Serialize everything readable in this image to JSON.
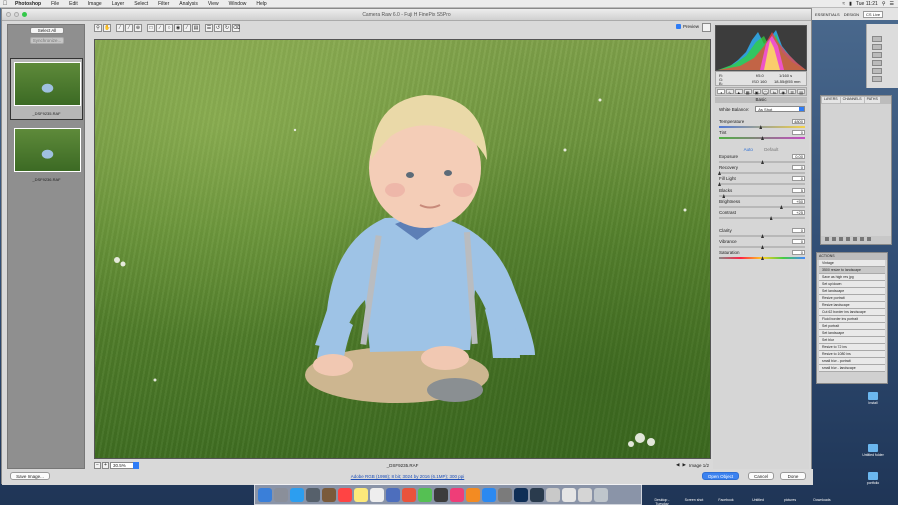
{
  "menubar": {
    "apple": "",
    "items": [
      "Photoshop",
      "File",
      "Edit",
      "Image",
      "Layer",
      "Select",
      "Filter",
      "Analysis",
      "View",
      "Window",
      "Help"
    ],
    "clock": "Tue 11:21"
  },
  "dialog": {
    "title": "Camera Raw 6.0 - Fuji H FinePix S5Pro",
    "select_all": "Select All",
    "synchronize": "Synchronize...",
    "thumbnails": [
      {
        "name": "_DSF9235.RAF",
        "selected": true
      },
      {
        "name": "_DSF9236.RAF",
        "selected": false
      }
    ],
    "preview_label": "Preview",
    "zoom": "30.5%",
    "filename": "_DSF9235.RAF",
    "image_count": "Image 1/2",
    "info_link": "Adobe RGB (1998); 8 bit; 3024 by 2016 (6.1MP); 300 ppi",
    "save_button": "Save Image...",
    "open_button": "Open Object",
    "cancel_button": "Cancel",
    "done_button": "Done"
  },
  "rawpanel": {
    "readout": {
      "r_label": "R:",
      "g_label": "G:",
      "b_label": "B:",
      "aperture": "f/5.0",
      "shutter": "1/160 s",
      "iso": "ISO 160",
      "lens": "18-55@55 mm"
    },
    "section": "Basic",
    "white_balance_label": "White Balance:",
    "white_balance_value": "As Shot",
    "auto": "Auto",
    "default": "Default",
    "sliders": [
      {
        "label": "Temperature",
        "value": "4800",
        "pos": 0.48,
        "track": "temp"
      },
      {
        "label": "Tint",
        "value": "0",
        "pos": 0.5,
        "track": "tint"
      },
      {
        "label": "Exposure",
        "value": "0.00",
        "pos": 0.5,
        "track": "plain"
      },
      {
        "label": "Recovery",
        "value": "0",
        "pos": 0.0,
        "track": "plain"
      },
      {
        "label": "Fill Light",
        "value": "0",
        "pos": 0.0,
        "track": "plain"
      },
      {
        "label": "Blacks",
        "value": "5",
        "pos": 0.05,
        "track": "plain"
      },
      {
        "label": "Brightness",
        "value": "+50",
        "pos": 0.72,
        "track": "plain"
      },
      {
        "label": "Contrast",
        "value": "+25",
        "pos": 0.6,
        "track": "plain"
      },
      {
        "label": "Clarity",
        "value": "0",
        "pos": 0.5,
        "track": "plain"
      },
      {
        "label": "Vibrance",
        "value": "0",
        "pos": 0.5,
        "track": "plain"
      },
      {
        "label": "Saturation",
        "value": "0",
        "pos": 0.5,
        "track": "sat"
      }
    ]
  },
  "photoshop": {
    "essentials": "ESSENTIALS",
    "design": "DESIGN",
    "cs_live": "CS Live",
    "layers_tabs": [
      "LAYERS",
      "CHANNELS",
      "PATHS"
    ],
    "actions_title": "ACTIONS",
    "actions": [
      "Vintage",
      "3500 resize to landscape",
      "Save as high res jpg",
      "Set up/down",
      "Set landscape",
      "Resize portrait",
      "Resize landscape",
      "Cut 62 border ins landscape",
      "Fluid border ins portrait",
      "Set portrait",
      "Set landscape",
      "Set blur",
      "Resize to 72 ins",
      "Resize to 1080 ins",
      "small b/w - portrait",
      "small b/w - landscape"
    ]
  },
  "desktop": {
    "icons": [
      "Install",
      "Untitled folder",
      "portfolio"
    ]
  },
  "dock": {
    "right_items": [
      "Desktop - Tuesday",
      "Screen shot",
      "Facebook",
      "Untitled",
      "pictures",
      "Downloads"
    ]
  }
}
